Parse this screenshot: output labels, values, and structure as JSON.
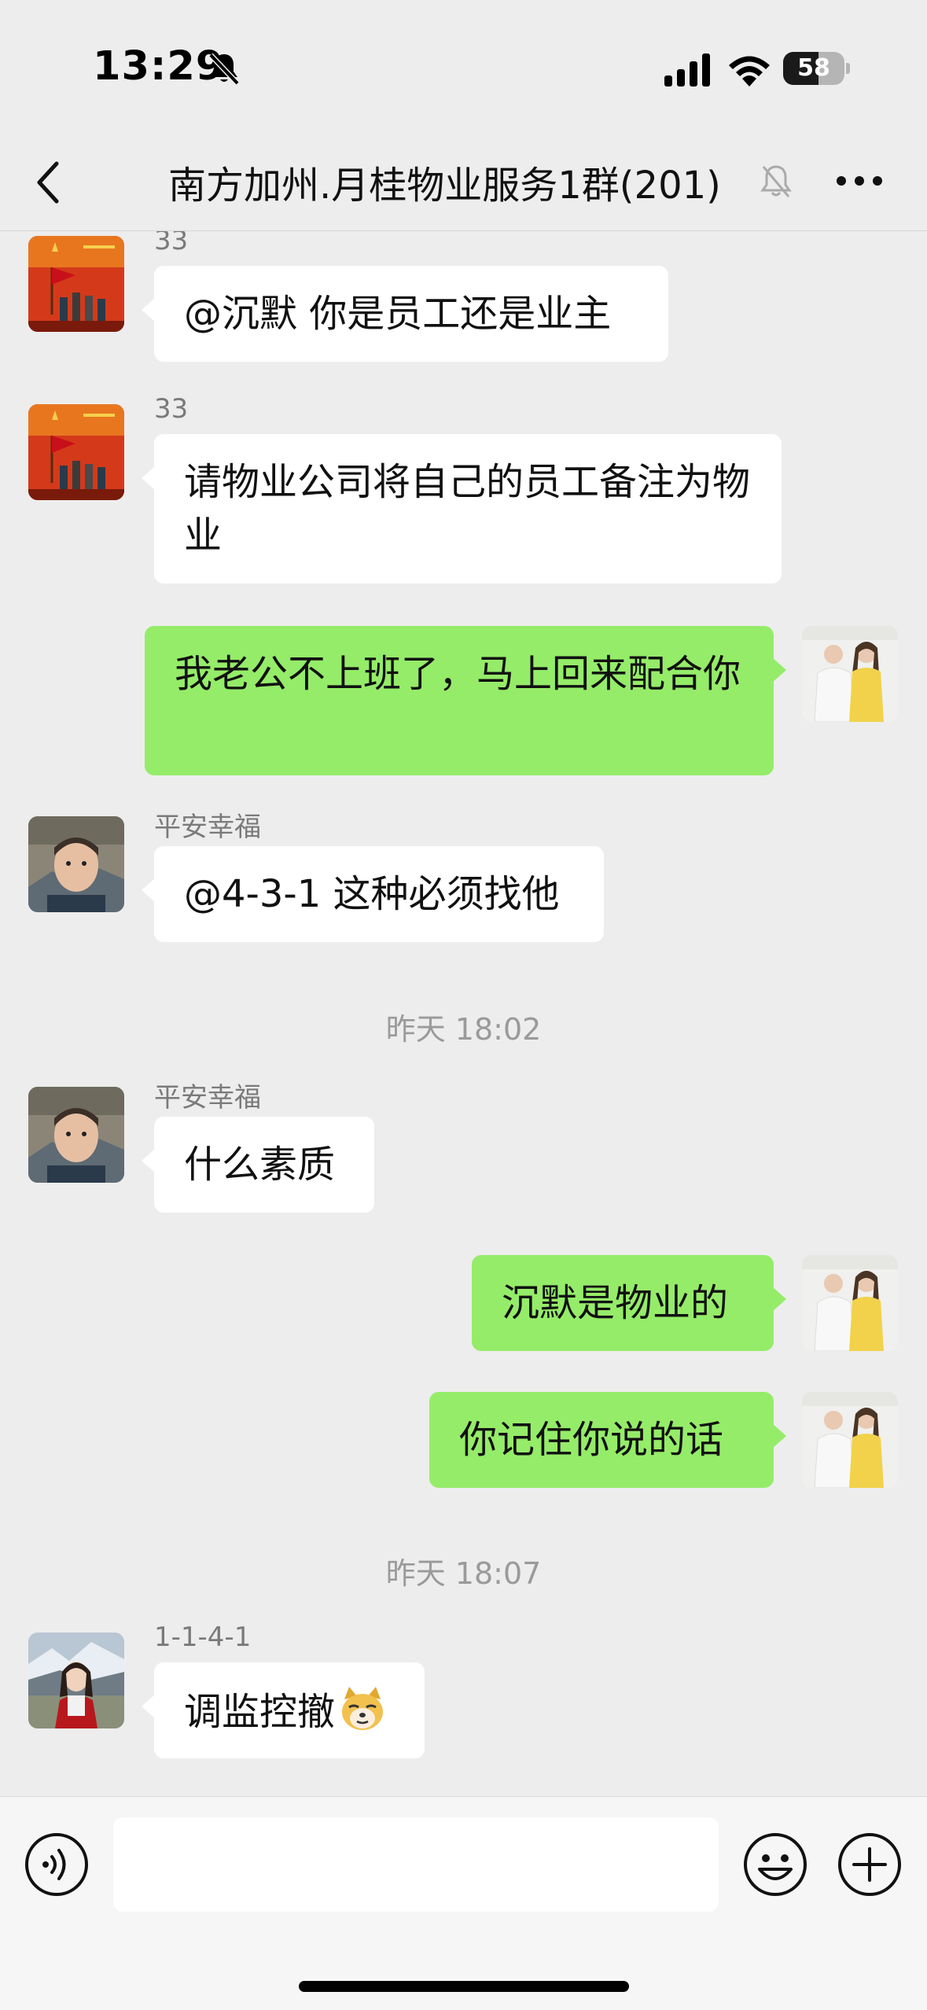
{
  "status_bar": {
    "time": "13:29",
    "battery_percent": "58",
    "battery_level": 0.58
  },
  "nav": {
    "title": "南方加州.月桂物业服务1群(201)"
  },
  "messages": [
    {
      "sender": "33",
      "text": "@沉默 你是员工还是业主"
    },
    {
      "sender": "33",
      "text": "请物业公司将自己的员工备注为物业"
    },
    {
      "text": "我老公不上班了，马上回来配合你"
    },
    {
      "sender": "平安幸福",
      "text": "@4-3-1 这种必须找他"
    },
    {
      "time": "昨天 18:02"
    },
    {
      "sender": "平安幸福",
      "text": "什么素质"
    },
    {
      "text": "沉默是物业的"
    },
    {
      "text": "你记住你说的话"
    },
    {
      "time": "昨天 18:07"
    },
    {
      "sender": "1-1-4-1",
      "text": "调监控撤",
      "emoji": "doge"
    }
  ],
  "input": {
    "placeholder": ""
  },
  "colors": {
    "background": "#ededed",
    "outgoing_bubble": "#95ec69",
    "incoming_bubble": "#ffffff"
  },
  "icons": [
    "bell-off-icon",
    "cellular-signal-icon",
    "wifi-icon",
    "battery-icon",
    "back-icon",
    "mute-bell-icon",
    "more-icon",
    "voice-icon",
    "emoji-icon",
    "plus-icon",
    "doge-emoji"
  ]
}
